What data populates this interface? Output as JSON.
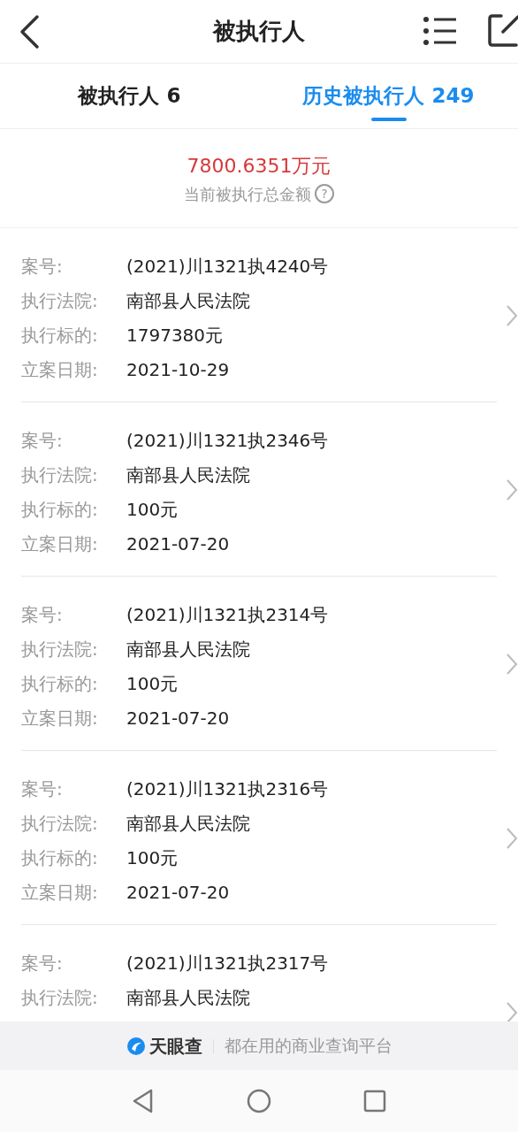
{
  "header": {
    "title": "被执行人"
  },
  "tabs": [
    {
      "label": "被执行人 6",
      "selected": false
    },
    {
      "label": "历史被执行人 249",
      "selected": true
    }
  ],
  "summary": {
    "amount": "7800.6351万元",
    "caption": "当前被执行总金额",
    "help_icon": "?"
  },
  "cases": [
    {
      "fields": [
        {
          "label": "案号:",
          "value": "(2021)川1321执4240号"
        },
        {
          "label": "执行法院:",
          "value": "南部县人民法院"
        },
        {
          "label": "执行标的:",
          "value": "1797380元"
        },
        {
          "label": "立案日期:",
          "value": "2021-10-29"
        }
      ]
    },
    {
      "fields": [
        {
          "label": "案号:",
          "value": "(2021)川1321执2346号"
        },
        {
          "label": "执行法院:",
          "value": "南部县人民法院"
        },
        {
          "label": "执行标的:",
          "value": "100元"
        },
        {
          "label": "立案日期:",
          "value": "2021-07-20"
        }
      ]
    },
    {
      "fields": [
        {
          "label": "案号:",
          "value": "(2021)川1321执2314号"
        },
        {
          "label": "执行法院:",
          "value": "南部县人民法院"
        },
        {
          "label": "执行标的:",
          "value": "100元"
        },
        {
          "label": "立案日期:",
          "value": "2021-07-20"
        }
      ]
    },
    {
      "fields": [
        {
          "label": "案号:",
          "value": "(2021)川1321执2316号"
        },
        {
          "label": "执行法院:",
          "value": "南部县人民法院"
        },
        {
          "label": "执行标的:",
          "value": "100元"
        },
        {
          "label": "立案日期:",
          "value": "2021-07-20"
        }
      ]
    },
    {
      "fields": [
        {
          "label": "案号:",
          "value": "(2021)川1321执2317号"
        },
        {
          "label": "执行法院:",
          "value": "南部县人民法院"
        }
      ]
    }
  ],
  "footer": {
    "brand": "天眼查",
    "slogan": "都在用的商业查询平台"
  }
}
